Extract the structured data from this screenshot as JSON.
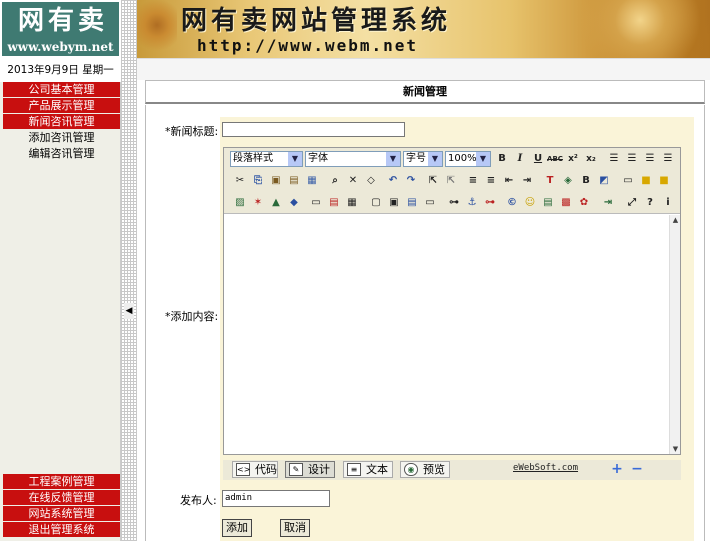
{
  "header": {
    "logo_text": "网有卖",
    "logo_url": "www.webym.net",
    "banner_title": "网有卖网站管理系统",
    "banner_url": "http://www.webm.net"
  },
  "sidebar": {
    "date": "2013年9月9日  星期一",
    "top_items": [
      {
        "label": "公司基本管理"
      },
      {
        "label": "产品展示管理"
      },
      {
        "label": "新闻咨讯管理"
      }
    ],
    "sub_items": [
      {
        "label": "添加咨讯管理"
      },
      {
        "label": "编辑咨讯管理"
      }
    ],
    "bottom_items": [
      {
        "label": "工程案例管理"
      },
      {
        "label": "在线反馈管理"
      },
      {
        "label": "网站系统管理"
      },
      {
        "label": "退出管理系统"
      }
    ]
  },
  "panel": {
    "title": "新闻管理"
  },
  "form": {
    "title_label": "*新闻标题:",
    "title_value": "",
    "content_label": "*添加内容:",
    "publisher_label": "发布人:",
    "publisher_value": "admin",
    "submit_label": "添加",
    "cancel_label": "取消"
  },
  "editor": {
    "paragraph_style": "段落样式",
    "font_name": "字体",
    "font_size": "字号",
    "zoom": "100%",
    "modes": [
      {
        "label": "代码",
        "icon": "code-icon"
      },
      {
        "label": "设计",
        "icon": "design-icon"
      },
      {
        "label": "文本",
        "icon": "text-icon"
      },
      {
        "label": "预览",
        "icon": "preview-icon"
      }
    ],
    "brand": "eWebSoft.com"
  },
  "colors": {
    "nav_red": "#c80f0f",
    "logo_teal": "#3f7a72",
    "form_bg": "#faf4d8",
    "toolbar_bg": "#ece9d8"
  }
}
